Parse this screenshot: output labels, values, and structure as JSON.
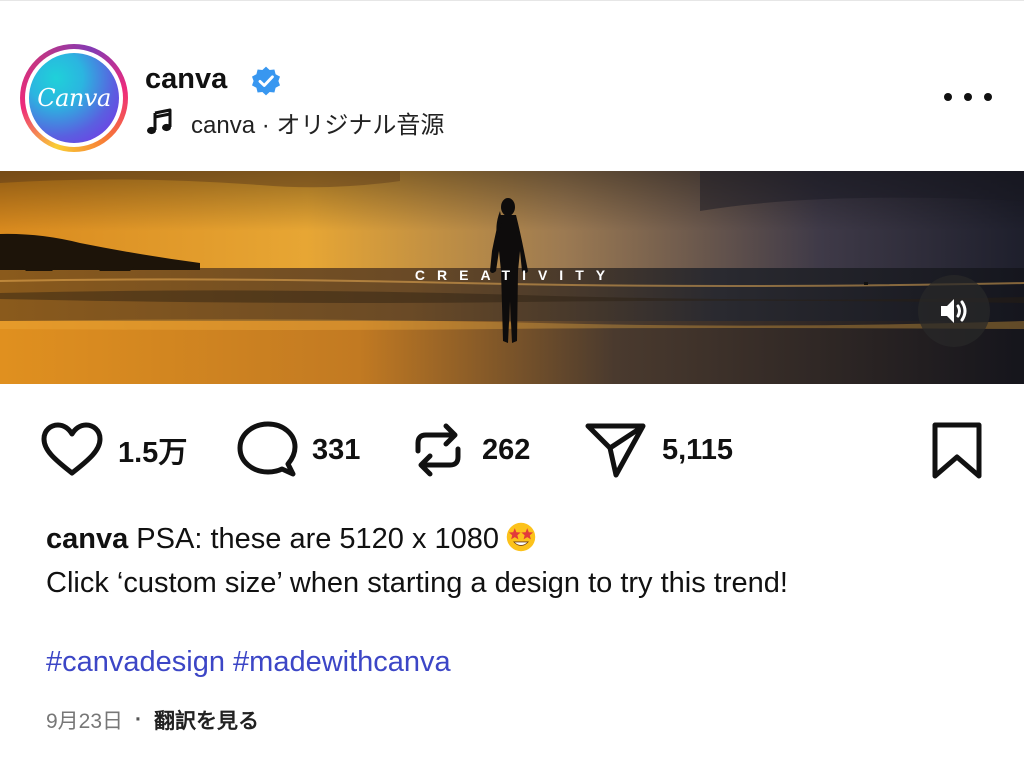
{
  "header": {
    "avatar_text": "Canva",
    "username": "canva",
    "audio": "canva · オリジナル音源",
    "icons": [
      "verified-badge-icon",
      "music-note-icon",
      "more-options-icon"
    ]
  },
  "banner": {
    "overlay_text": "CREATIVITY",
    "sound_icon": "speaker-on-icon"
  },
  "actions": {
    "likes": "1.5万",
    "comments": "331",
    "reposts": "262",
    "shares": "5,115"
  },
  "caption": {
    "username": "canva",
    "line1": "PSA: these are 5120 x 1080",
    "emoji": "star-struck-emoji",
    "line2": "Click ‘custom size’ when starting a design to try this trend!",
    "hashtag1": "#canvadesign",
    "hashtag2": "#madewithcanva"
  },
  "meta": {
    "date": "9月23日",
    "separator": "·",
    "translate": "翻訳を見る"
  },
  "colors": {
    "hashtag": "#3c46c6",
    "verified": "#3897f0",
    "text": "#111111",
    "muted": "#777777"
  }
}
